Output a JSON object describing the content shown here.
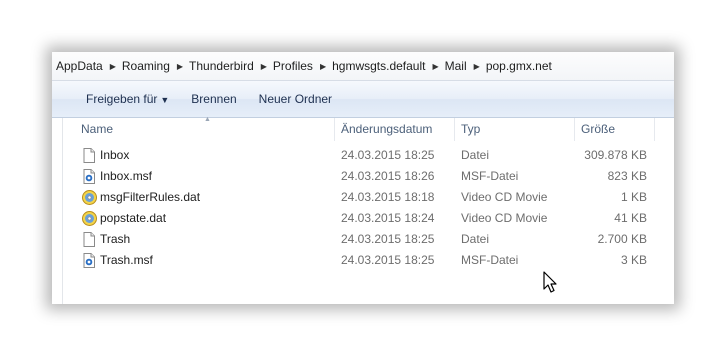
{
  "breadcrumb": [
    "AppData",
    "Roaming",
    "Thunderbird",
    "Profiles",
    "hgmwsgts.default",
    "Mail",
    "pop.gmx.net"
  ],
  "toolbar": {
    "share_label": "Freigeben für",
    "burn_label": "Brennen",
    "new_folder_label": "Neuer Ordner"
  },
  "columns": {
    "name": "Name",
    "date": "Änderungsdatum",
    "type": "Typ",
    "size": "Größe"
  },
  "files": [
    {
      "name": "Inbox",
      "date": "24.03.2015 18:25",
      "type": "Datei",
      "size": "309.878 KB",
      "icon": "blank-file-icon"
    },
    {
      "name": "Inbox.msf",
      "date": "24.03.2015 18:26",
      "type": "MSF-Datei",
      "size": "823 KB",
      "icon": "msf-file-icon"
    },
    {
      "name": "msgFilterRules.dat",
      "date": "24.03.2015 18:18",
      "type": "Video CD Movie",
      "size": "1 KB",
      "icon": "video-cd-icon"
    },
    {
      "name": "popstate.dat",
      "date": "24.03.2015 18:24",
      "type": "Video CD Movie",
      "size": "41 KB",
      "icon": "video-cd-icon"
    },
    {
      "name": "Trash",
      "date": "24.03.2015 18:25",
      "type": "Datei",
      "size": "2.700 KB",
      "icon": "blank-file-icon"
    },
    {
      "name": "Trash.msf",
      "date": "24.03.2015 18:25",
      "type": "MSF-Datei",
      "size": "3 KB",
      "icon": "msf-file-icon"
    }
  ]
}
